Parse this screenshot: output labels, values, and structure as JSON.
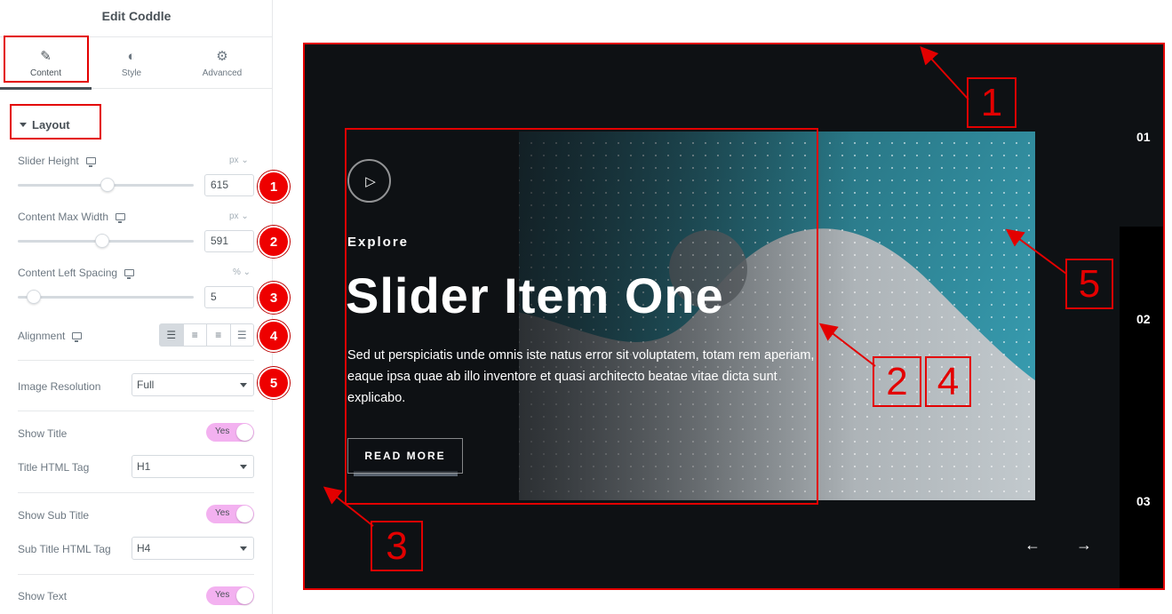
{
  "editor": {
    "title": "Edit Coddle",
    "tabs": [
      {
        "label": "Content",
        "icon": "pencil-icon"
      },
      {
        "label": "Style",
        "icon": "contrast-icon"
      },
      {
        "label": "Advanced",
        "icon": "gear-icon"
      }
    ],
    "section_title": "Layout",
    "controls": {
      "slider_height": {
        "label": "Slider Height",
        "unit": "px",
        "value": "615",
        "fill": 0.47
      },
      "content_max_width": {
        "label": "Content Max Width",
        "unit": "px",
        "value": "591",
        "fill": 0.44
      },
      "content_left_spacing": {
        "label": "Content Left Spacing",
        "unit": "%",
        "value": "5",
        "fill": 0.05
      },
      "alignment": {
        "label": "Alignment",
        "options": [
          "left",
          "center",
          "right",
          "justify"
        ],
        "selected": "left"
      },
      "image_resolution": {
        "label": "Image Resolution",
        "value": "Full"
      },
      "show_title": {
        "label": "Show Title",
        "value": "Yes"
      },
      "title_tag": {
        "label": "Title HTML Tag",
        "value": "H1"
      },
      "show_sub_title": {
        "label": "Show Sub Title",
        "value": "Yes"
      },
      "sub_title_tag": {
        "label": "Sub Title HTML Tag",
        "value": "H4"
      },
      "show_text": {
        "label": "Show Text",
        "value": "Yes"
      }
    },
    "badges": [
      "1",
      "2",
      "3",
      "4",
      "5"
    ]
  },
  "slider": {
    "subtitle": "Explore",
    "title": "Slider Item One",
    "description": "Sed ut perspiciatis unde omnis iste natus error sit voluptatem, totam rem aperiam, eaque ipsa quae ab illo inventore et quasi architecto beatae vitae dicta sunt explicabo.",
    "button_label": "READ MORE",
    "nav": [
      "01",
      "02",
      "03"
    ],
    "prev_arrow": "←",
    "next_arrow": "→"
  },
  "callouts": [
    "1",
    "2",
    "4",
    "3",
    "5"
  ],
  "colors": {
    "accent_red": "#e30000",
    "toggle_pink": "#f3b1f0",
    "slide_bg": "#0e1114"
  }
}
